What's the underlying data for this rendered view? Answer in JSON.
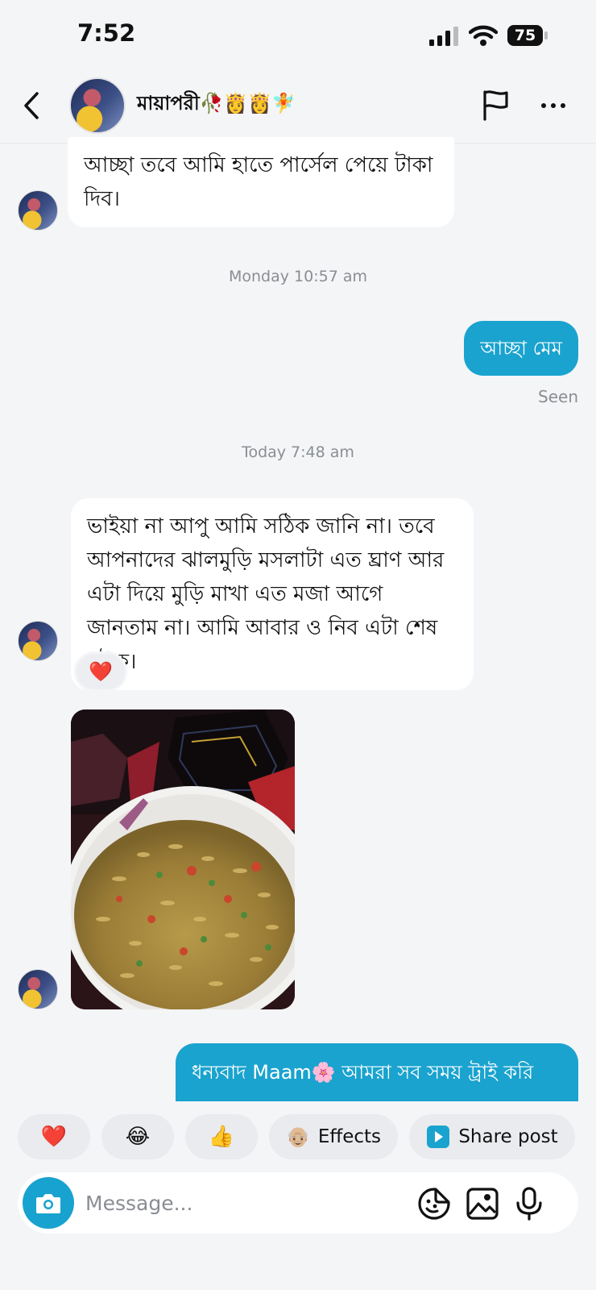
{
  "status_bar": {
    "time": "7:52",
    "battery": "75"
  },
  "header": {
    "contact_name": "মায়াপরী🥀👸👸🧚"
  },
  "messages": {
    "m1": "আচ্ছা তবে আমি হাতে পার্সেল  পেয়ে টাকা দিব।",
    "ts1": "Monday 10:57 am",
    "m2": "আচ্ছা মেম",
    "seen": "Seen",
    "ts2": "Today 7:48 am",
    "m3": "ভাইয়া না আপু আমি সঠিক জানি না। তবে আপনাদের ঝালমুড়ি মসলাটা এত ঘ্রাণ আর এটা দিয়ে মুড়ি মাখা এত মজা আগে জানতাম না। আমি আবার ও নিব এটা শেষ হউক।",
    "m3_reaction": "❤️",
    "m4": "ধন্যবাদ Maam🌸 আমরা সব সময় ট্রাই করি"
  },
  "quick_reactions": {
    "heart": "❤️",
    "laugh": "😂",
    "thumbs": "👍",
    "effects_emoji": "👴🏼",
    "effects_label": "Effects",
    "share_label": "Share post"
  },
  "composer": {
    "placeholder": "Message..."
  },
  "colors": {
    "accent": "#1aa3cf",
    "background": "#f4f5f7",
    "incoming_bubble": "#ffffff"
  },
  "icons": [
    "chevron-left-icon",
    "flag-icon",
    "more-icon",
    "camera-icon",
    "sticker-icon",
    "gallery-icon",
    "microphone-icon"
  ]
}
